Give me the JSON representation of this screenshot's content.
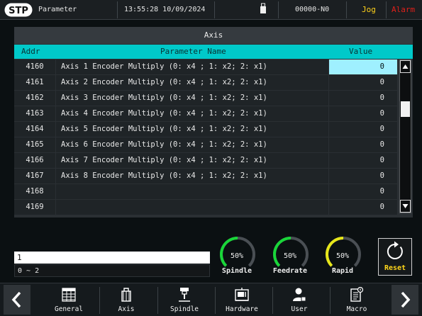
{
  "status_bar": {
    "screen_title": "Parameter",
    "datetime": "13:55:28 10/09/2024",
    "program": "00000-N0",
    "mode": "Jog",
    "alarm": "Alarm",
    "mode_color": "#ffd21a",
    "alarm_color": "#e0201a"
  },
  "panel": {
    "title": "Axis",
    "headers": {
      "addr": "Addr",
      "name": "Parameter Name",
      "value": "Value"
    },
    "rows": [
      {
        "addr": "4160",
        "name": "Axis 1 Encoder Multiply (0: x4 ; 1: x2; 2: x1)",
        "value": "0",
        "selected": true
      },
      {
        "addr": "4161",
        "name": "Axis 2 Encoder Multiply (0: x4 ; 1: x2; 2: x1)",
        "value": "0"
      },
      {
        "addr": "4162",
        "name": "Axis 3 Encoder Multiply (0: x4 ; 1: x2; 2: x1)",
        "value": "0"
      },
      {
        "addr": "4163",
        "name": "Axis 4 Encoder Multiply (0: x4 ; 1: x2; 2: x1)",
        "value": "0"
      },
      {
        "addr": "4164",
        "name": "Axis 5 Encoder Multiply (0: x4 ; 1: x2; 2: x1)",
        "value": "0"
      },
      {
        "addr": "4165",
        "name": "Axis 6 Encoder Multiply (0: x4 ; 1: x2; 2: x1)",
        "value": "0"
      },
      {
        "addr": "4166",
        "name": "Axis 7 Encoder Multiply (0: x4 ; 1: x2; 2: x1)",
        "value": "0"
      },
      {
        "addr": "4167",
        "name": "Axis 8 Encoder Multiply (0: x4 ; 1: x2; 2: x1)",
        "value": "0"
      },
      {
        "addr": "4168",
        "name": "",
        "value": "0"
      },
      {
        "addr": "4169",
        "name": "",
        "value": "0"
      }
    ]
  },
  "input": {
    "value": "1",
    "range": "0 ~ 2"
  },
  "gauges": [
    {
      "label": "Spindle",
      "value_text": "50%",
      "fraction": 0.5,
      "color": "#19d639"
    },
    {
      "label": "Feedrate",
      "value_text": "50%",
      "fraction": 0.5,
      "color": "#19d639"
    },
    {
      "label": "Rapid",
      "value_text": "50%",
      "fraction": 0.5,
      "color": "#e6e61a"
    }
  ],
  "reset": {
    "label": "Reset",
    "icon": "refresh-icon"
  },
  "bottom_nav": {
    "prev_icon": "chevron-left-icon",
    "next_icon": "chevron-right-icon",
    "tabs": [
      {
        "label": "General",
        "icon": "grid-table-icon"
      },
      {
        "label": "Axis",
        "icon": "motor-icon"
      },
      {
        "label": "Spindle",
        "icon": "spindle-icon"
      },
      {
        "label": "Hardware",
        "icon": "machine-icon"
      },
      {
        "label": "User",
        "icon": "user-icon"
      },
      {
        "label": "Macro",
        "icon": "macro-doc-icon"
      }
    ]
  }
}
